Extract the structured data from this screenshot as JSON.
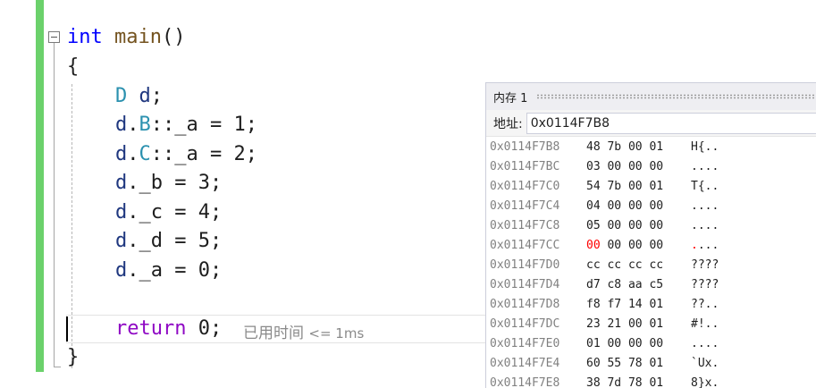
{
  "code": {
    "signature": {
      "keyword": "int",
      "function": "main",
      "parens": "()"
    },
    "open_brace": "{",
    "decl": {
      "type": "D",
      "var": "d",
      "semi": ";"
    },
    "assign_b": {
      "obj": "d",
      "dot": ".",
      "type": "B",
      "rest": "::_a = 1;"
    },
    "assign_c": {
      "obj": "d",
      "dot": ".",
      "type": "C",
      "rest": "::_a = 2;"
    },
    "assign_bb": {
      "obj": "d",
      "rest": "._b = 3;"
    },
    "assign_cc": {
      "obj": "d",
      "rest": "._c = 4;"
    },
    "assign_dd": {
      "obj": "d",
      "rest": "._d = 5;"
    },
    "assign_aa": {
      "obj": "d",
      "rest": "._a = 0;"
    },
    "return_kw": "return",
    "return_rest": " 0;",
    "close_brace": "}",
    "perf_tip": {
      "label": "已用时间",
      "value": "<= 1ms"
    }
  },
  "memory_window": {
    "title": "内存 1",
    "address_label": "地址:",
    "address_value": "0x0114F7B8",
    "rows": [
      {
        "addr": "0x0114F7B8",
        "b0": "48",
        "rest": " 7b 00 01",
        "ascii": "H{.."
      },
      {
        "addr": "0x0114F7BC",
        "b0": "03",
        "rest": " 00 00 00",
        "ascii": "...."
      },
      {
        "addr": "0x0114F7C0",
        "b0": "54",
        "rest": " 7b 00 01",
        "ascii": "T{.."
      },
      {
        "addr": "0x0114F7C4",
        "b0": "04",
        "rest": " 00 00 00",
        "ascii": "...."
      },
      {
        "addr": "0x0114F7C8",
        "b0": "05",
        "rest": " 00 00 00",
        "ascii": "...."
      },
      {
        "addr": "0x0114F7CC",
        "b0": "00",
        "rest": " 00 00 00",
        "ascii0": ".",
        "ascii": "..."
      },
      {
        "addr": "0x0114F7D0",
        "b0": "cc",
        "rest": " cc cc cc",
        "ascii": "????"
      },
      {
        "addr": "0x0114F7D4",
        "b0": "d7",
        "rest": " c8 aa c5",
        "ascii": "????"
      },
      {
        "addr": "0x0114F7D8",
        "b0": "f8",
        "rest": " f7 14 01",
        "ascii": "??.."
      },
      {
        "addr": "0x0114F7DC",
        "b0": "23",
        "rest": " 21 00 01",
        "ascii": "#!.."
      },
      {
        "addr": "0x0114F7E0",
        "b0": "01",
        "rest": " 00 00 00",
        "ascii": "...."
      },
      {
        "addr": "0x0114F7E4",
        "b0": "60",
        "rest": " 55 78 01",
        "ascii": "`Ux."
      },
      {
        "addr": "0x0114F7E8",
        "b0": "38",
        "rest": " 7d 78 01",
        "ascii": "8}x."
      }
    ]
  },
  "colors": {
    "keyword": "#0000ff",
    "control_keyword": "#8f08c4",
    "function": "#74531f",
    "variable": "#1f377f",
    "type": "#2b91af",
    "changed_byte": "#ff0000",
    "change_bar": "#6bd16b"
  }
}
